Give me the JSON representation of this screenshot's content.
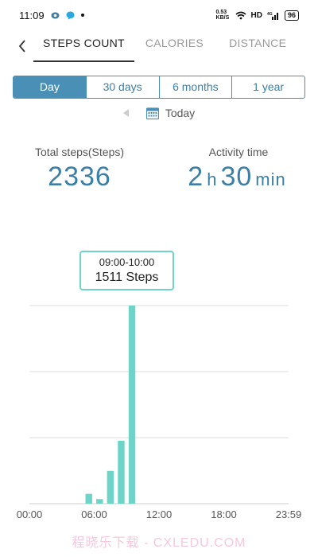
{
  "status_bar": {
    "time": "11:09",
    "network_speed": "0.53 KB/S",
    "hd": "HD",
    "signal": "4G",
    "battery": "96"
  },
  "tabs": [
    {
      "label": "STEPS COUNT",
      "active": true
    },
    {
      "label": "CALORIES",
      "active": false
    },
    {
      "label": "DISTANCE",
      "active": false
    }
  ],
  "range": [
    {
      "label": "Day",
      "active": true
    },
    {
      "label": "30 days",
      "active": false
    },
    {
      "label": "6 months",
      "active": false
    },
    {
      "label": "1 year",
      "active": false
    }
  ],
  "date": {
    "label": "Today"
  },
  "stats": {
    "total_steps_label": "Total steps(Steps)",
    "total_steps_value": "2336",
    "activity_label": "Activity time",
    "activity_hours": "2",
    "activity_h_unit": "h",
    "activity_minutes": "30",
    "activity_min_unit": "min"
  },
  "tooltip": {
    "time": "09:00-10:00",
    "steps": "1511 Steps"
  },
  "chart_data": {
    "type": "bar",
    "x_ticks": [
      "00:00",
      "06:00",
      "12:00",
      "18:00",
      "23:59"
    ],
    "hours": [
      5,
      6,
      7,
      8,
      9
    ],
    "values": [
      75,
      35,
      250,
      480,
      1511
    ],
    "ylim": [
      0,
      1511
    ],
    "grid": true,
    "colors": {
      "bar": "#6fd4c8",
      "bar_edge": "#4aa8a0",
      "grid": "#dddddd",
      "axis": "#cccccc"
    }
  },
  "watermark": "程晓乐下载 - CXLEDU.COM",
  "colors": {
    "accent": "#4a8fb5",
    "value_text": "#3b7fa6",
    "highlight": "#6fd4c8"
  }
}
